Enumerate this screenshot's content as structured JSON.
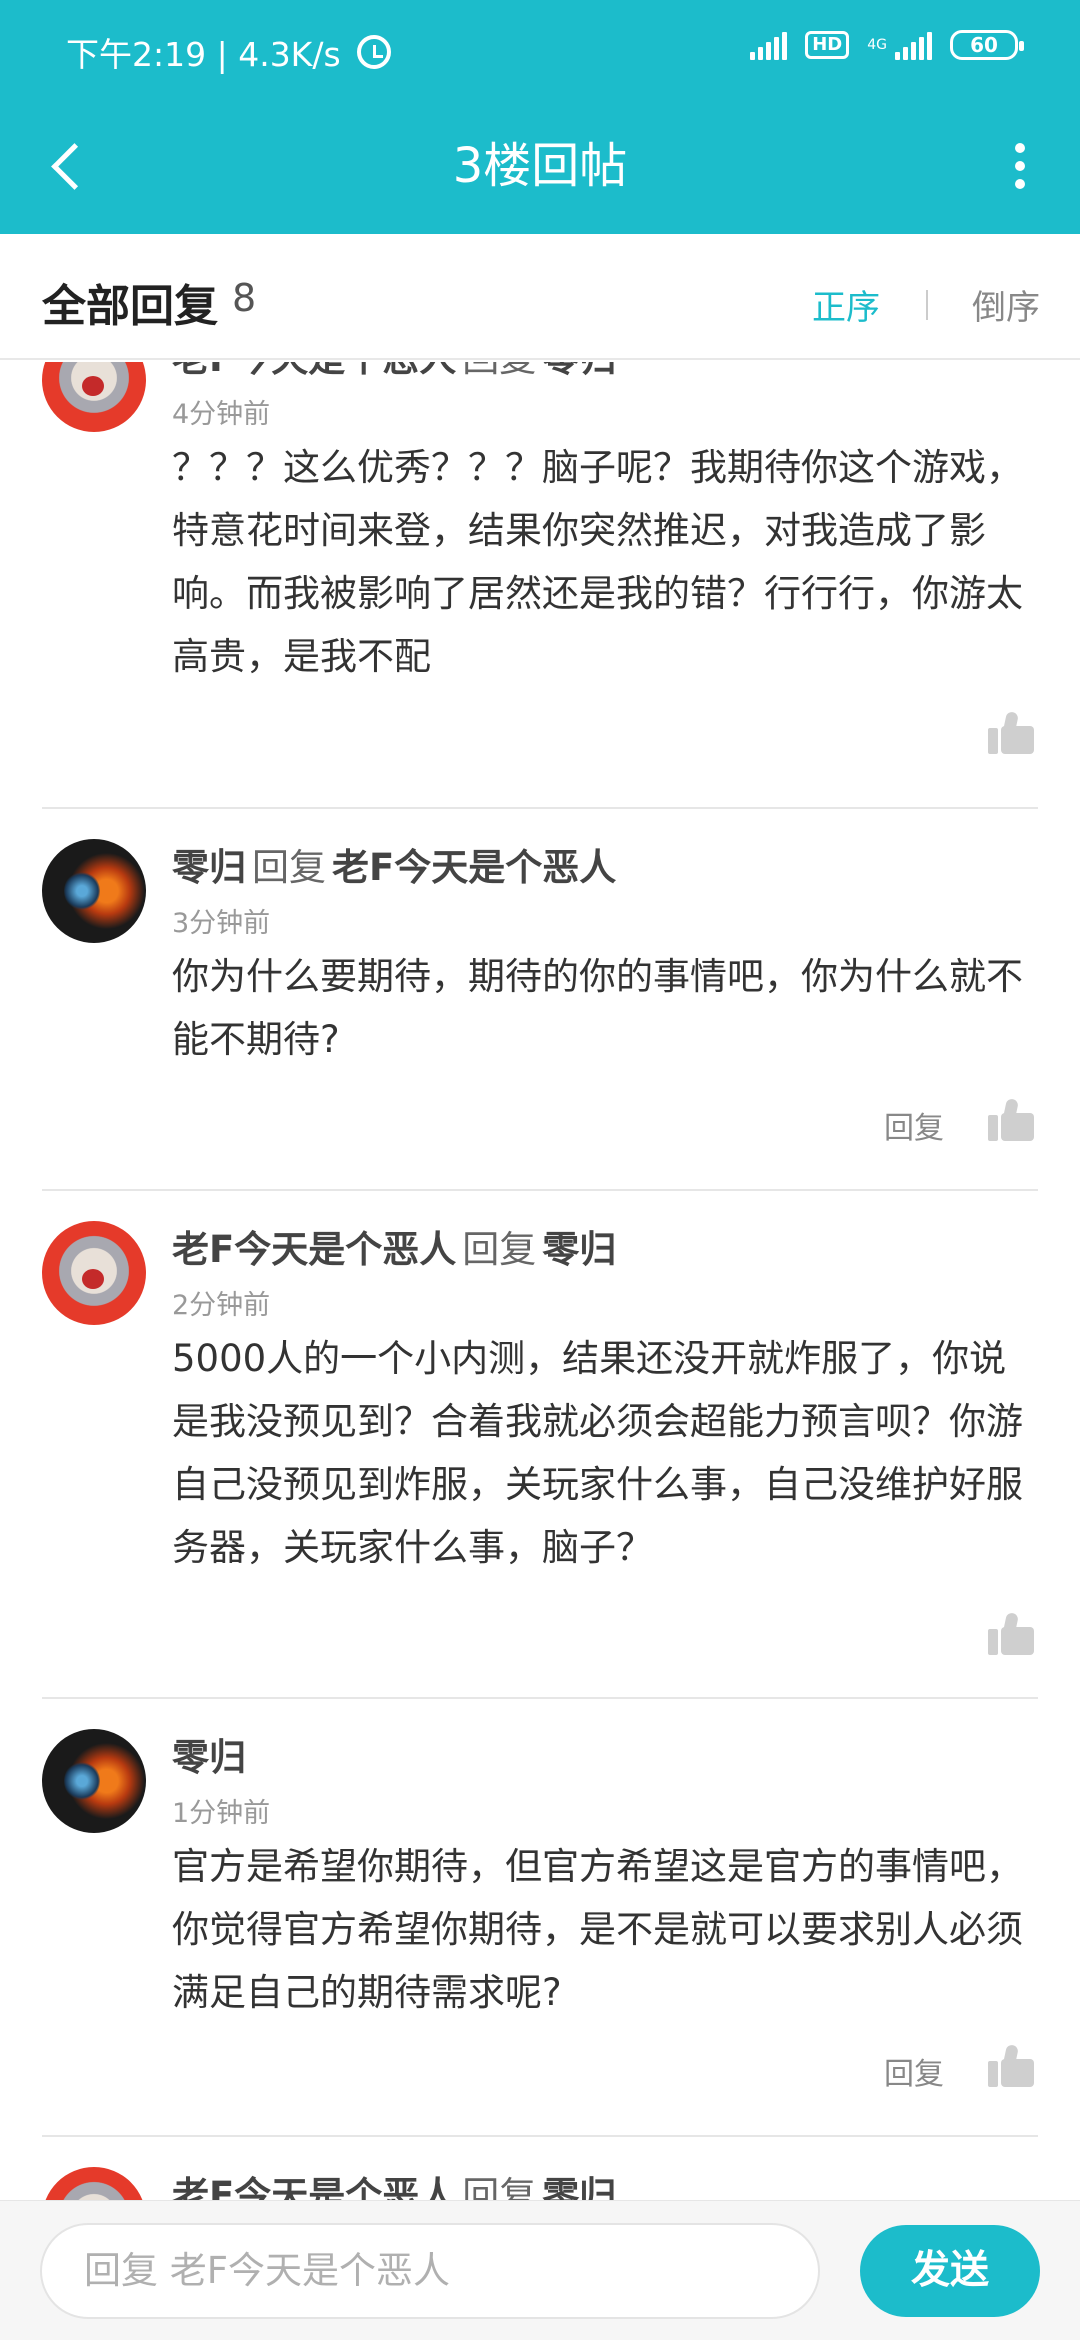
{
  "status_bar": {
    "time_speed": "下午2:19 | 4.3K/s",
    "network_hd": "HD",
    "network_4g": "4G",
    "battery": "60",
    "icons": [
      "alarm-icon",
      "signal-icon",
      "hd-icon",
      "4g-signal-icon",
      "battery-icon"
    ]
  },
  "appbar": {
    "title": "3楼回帖",
    "back_icon": "back-arrow-icon",
    "more_icon": "more-vertical-icon"
  },
  "header": {
    "all_replies_label": "全部回复",
    "count": "8",
    "sort_asc": "正序",
    "sort_desc": "倒序",
    "accent_color": "#1cbccb"
  },
  "replies": [
    {
      "author": "老F今天是个恶人",
      "reply_word": "回复",
      "reply_to": "零归",
      "time": "4分钟前",
      "content": "？？？这么优秀？？？脑子呢？我期待你这个游戏，特意花时间来登，结果你突然推迟，对我造成了影响。而我被影响了居然还是我的错？行行行，你游太高贵，是我不配",
      "show_reply": false
    },
    {
      "author": "零归",
      "reply_word": "回复",
      "reply_to": "老F今天是个恶人",
      "time": "3分钟前",
      "content": "你为什么要期待，期待的你的事情吧，你为什么就不能不期待?",
      "reply_label": "回复",
      "show_reply": true
    },
    {
      "author": "老F今天是个恶人",
      "reply_word": "回复",
      "reply_to": "零归",
      "time": "2分钟前",
      "content": "5000人的一个小内测，结果还没开就炸服了，你说是我没预见到？合着我就必须会超能力预言呗？你游自己没预见到炸服，关玩家什么事，自己没维护好服务器，关玩家什么事，脑子？",
      "show_reply": false
    },
    {
      "author": "零归",
      "time": "1分钟前",
      "content": "官方是希望你期待，但官方希望这是官方的事情吧，你觉得官方希望你期待，是不是就可以要求别人必须满足自己的期待需求呢?",
      "reply_label": "回复",
      "show_reply": true
    },
    {
      "author": "老F今天是个恶人",
      "reply_word": "回复",
      "reply_to": "零归"
    }
  ],
  "bottom": {
    "input_placeholder": "回复 老F今天是个恶人",
    "send_label": "发送"
  }
}
